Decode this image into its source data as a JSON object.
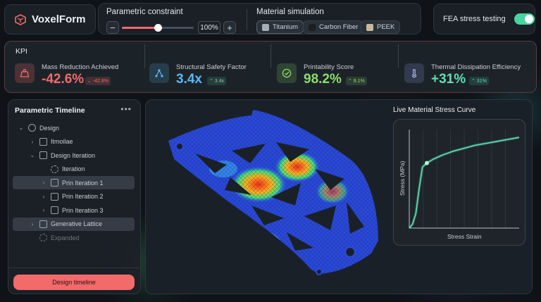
{
  "app": {
    "name": "VoxelForm",
    "logo_icon": "voxel-cube-icon"
  },
  "controls": {
    "parametric_label": "Parametric constraint",
    "slider_value": 1.0,
    "percent_text": "100%",
    "material_label": "Material simulation",
    "materials": [
      {
        "name": "Titanium",
        "swatch": "#a7adb5",
        "selected": true
      },
      {
        "name": "Carbon Fiber",
        "swatch": "#1b1f24",
        "selected": false
      },
      {
        "name": "PEEK",
        "swatch": "#c9b99a",
        "selected": false
      }
    ]
  },
  "fea": {
    "label": "FEA stress testing",
    "enabled": true,
    "accent": "#4ad39a"
  },
  "kpi": {
    "title": "KPI",
    "cards": [
      {
        "name": "Mass Reduction Achieved",
        "value": "-42.6%",
        "delta": "⌄ -42.8%",
        "color": "#f26a6a",
        "icon": "weight-icon"
      },
      {
        "name": "Structural Safety Factor",
        "value": "3.4x",
        "delta": "⌃ 3.4x",
        "color": "#5ab8f2",
        "icon": "network-icon"
      },
      {
        "name": "Printability Score",
        "value": "98.2%",
        "delta": "⌃ 8.1%",
        "color": "#8ddc6a",
        "icon": "check-circle-icon"
      },
      {
        "name": "Thermal Dissipation Efficiency",
        "value": "+31%",
        "delta": "⌃ 31%",
        "color": "#5fe0b4",
        "icon": "thermometer-icon"
      }
    ]
  },
  "timeline": {
    "title": "Parametric Timeline",
    "more_icon": "more-horizontal-icon",
    "items": [
      {
        "label": "Design",
        "chevron": "⌄",
        "icon": "plus-circle-icon",
        "indent": 0,
        "selected": false,
        "dim": false
      },
      {
        "label": "Itmoilae",
        "chevron": "›",
        "icon": "undo-icon",
        "indent": 1,
        "selected": false,
        "dim": false
      },
      {
        "label": "Design Iteration",
        "chevron": "⌄",
        "icon": "sliders-icon",
        "indent": 1,
        "selected": false,
        "dim": false
      },
      {
        "label": "Iteration",
        "chevron": "",
        "icon": "dashed-circle-icon",
        "indent": 2,
        "selected": false,
        "dim": false
      },
      {
        "label": "Prin Iteration 1",
        "chevron": "›",
        "icon": "layers-icon",
        "indent": 2,
        "selected": true,
        "dim": false
      },
      {
        "label": "Prin Iteration 2",
        "chevron": "›",
        "icon": "layers-icon",
        "indent": 2,
        "selected": false,
        "dim": false
      },
      {
        "label": "Prin Iteration 3",
        "chevron": "›",
        "icon": "layers-icon",
        "indent": 2,
        "selected": false,
        "dim": false
      },
      {
        "label": "Generative Lattice",
        "chevron": "›",
        "icon": "lattice-icon",
        "indent": 1,
        "selected": true,
        "dim": false
      },
      {
        "label": "Expanded",
        "chevron": "",
        "icon": "dashed-circle-icon",
        "indent": 1,
        "selected": false,
        "dim": true
      }
    ],
    "button_label": "Design timeline"
  },
  "stress_curve": {
    "title": "Live Material Stress Curve"
  },
  "chart_data": {
    "type": "line",
    "title": "Live Material Stress Curve",
    "xlabel": "Stress Strain",
    "ylabel": "Stress (MPa)",
    "grid": true,
    "x": [
      0,
      0.03,
      0.06,
      0.09,
      0.12,
      0.16,
      0.22,
      0.3,
      0.4,
      0.5,
      0.6,
      0.7,
      0.8,
      0.9,
      1.0
    ],
    "series": [
      {
        "values": [
          0,
          0.04,
          0.15,
          0.4,
          0.62,
          0.66,
          0.7,
          0.74,
          0.78,
          0.81,
          0.84,
          0.86,
          0.88,
          0.9,
          0.92
        ]
      }
    ],
    "marker_point": {
      "x": 0.16,
      "y": 0.66
    },
    "color": "#5fe0b4"
  }
}
